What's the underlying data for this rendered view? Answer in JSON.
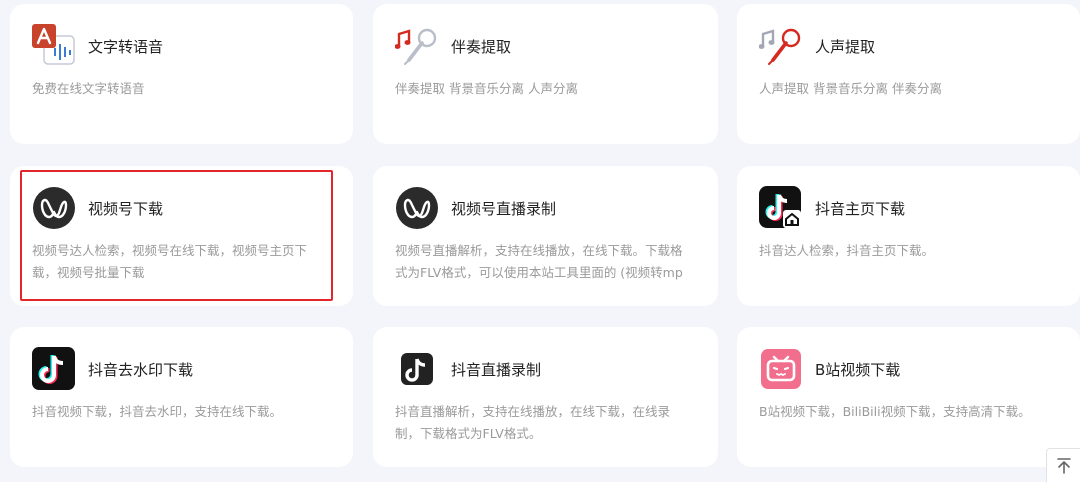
{
  "cards": [
    {
      "title": "文字转语音",
      "desc": "免费在线文字转语音",
      "icon": "text-to-speech-icon"
    },
    {
      "title": "伴奏提取",
      "desc": "伴奏提取 背景音乐分离 人声分离",
      "icon": "microphone-music-icon",
      "accent": "#e0321f"
    },
    {
      "title": "人声提取",
      "desc": "人声提取 背景音乐分离 伴奏分离",
      "icon": "microphone-music-icon",
      "accent": "#e0321f"
    },
    {
      "title": "视频号下载",
      "desc": "视频号达人检索，视频号在线下载，视频号主页下载，视频号批量下载",
      "icon": "wechat-channels-icon"
    },
    {
      "title": "视频号直播录制",
      "desc": "视频号直播解析，支持在线播放，在线下载。下载格式为FLV格式，可以使用本站工具里面的 (视频转mp",
      "icon": "wechat-channels-icon"
    },
    {
      "title": "抖音主页下载",
      "desc": "抖音达人检索，抖音主页下载。",
      "icon": "douyin-home-icon"
    },
    {
      "title": "抖音去水印下载",
      "desc": "抖音视频下载，抖音去水印，支持在线下载。",
      "icon": "douyin-icon"
    },
    {
      "title": "抖音直播录制",
      "desc": "抖音直播解析，支持在线播放，在线下载，在线录制，下载格式为FLV格式。",
      "icon": "douyin-icon"
    },
    {
      "title": "B站视频下载",
      "desc": "B站视频下载，BiliBili视频下载，支持高清下载。",
      "icon": "bilibili-icon",
      "accent": "#f16f8c"
    }
  ],
  "highlight_color": "#e3262c",
  "back_to_top": "back-to-top-icon"
}
